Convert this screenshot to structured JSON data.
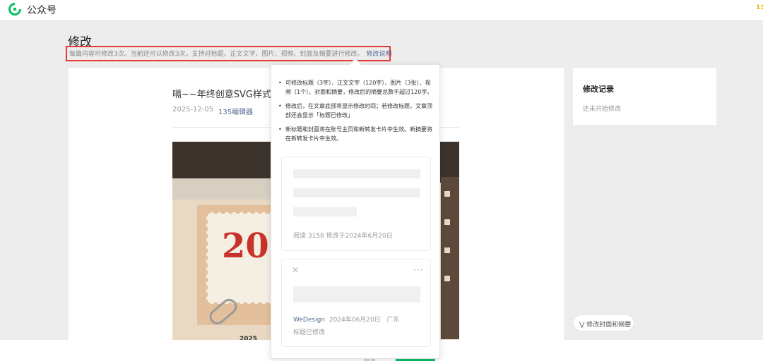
{
  "header": {
    "brand": "公众号",
    "logo_icon": "wechat-official-account-logo",
    "corner_mark": "13"
  },
  "page": {
    "title": "修改",
    "notice": "每篇内容可修改3次。当前还可以修改3次。支持对标题、正文文字、图片、视频、封面及摘要进行修改。",
    "notice_link": "修改说明"
  },
  "article": {
    "title": "嗝~~年终创意SVG样式，",
    "date": "2025-12-05",
    "author": "135编辑器",
    "cover_text": "20",
    "cover_bottom": "2025"
  },
  "popover": {
    "rules": [
      "可修改标题（3字）、正文文字（120字）、图片（3张）、视频（1个）、封面和摘要，修改后的摘要总数不超过120字。",
      "修改后，在文章底部将显示修改时间；若修改标题，文章顶部还会显示「标题已修改」",
      "新标题和封面将在账号主页和新转发卡片中生效。新摘要将在新转发卡片中生效。"
    ],
    "card1_meta": "阅读 3158    修改于2024年6月20日",
    "card2": {
      "author": "WeDesign",
      "date": "2024年06月20日",
      "region": "广东",
      "status": "标题已修改",
      "close_icon": "close-icon",
      "more_icon": "more-icon"
    }
  },
  "sidebar": {
    "title": "修改记录",
    "empty": "还未开始修改"
  },
  "actions": {
    "expand_label": "修改封面和摘要",
    "bottom_label": "取消"
  },
  "colors": {
    "accent_link": "#576b95",
    "highlight_border": "#e23b33",
    "brand_green": "#07c160"
  }
}
